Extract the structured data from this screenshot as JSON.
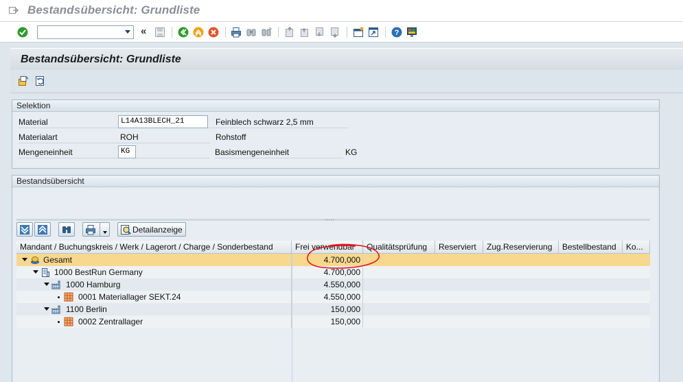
{
  "window": {
    "title": "Bestandsübersicht: Grundliste"
  },
  "toolbar": {
    "command_value": "",
    "more_symbol": "«"
  },
  "screen": {
    "title": "Bestandsübersicht: Grundliste"
  },
  "selektion": {
    "title": "Selektion",
    "material_label": "Material",
    "material_value": "L14A13BLECH_21",
    "material_text": "Feinblech schwarz 2,5 mm",
    "materialart_label": "Materialart",
    "materialart_value": "ROH",
    "materialart_text": "Rohstoff",
    "mengeneinheit_label": "Mengeneinheit",
    "mengeneinheit_value": "KG",
    "basismengeneinheit_label": "Basismengeneinheit",
    "basismengeneinheit_value": "KG"
  },
  "bestand": {
    "title": "Bestandsübersicht",
    "splitter": ".....",
    "detail_button": "Detailanzeige",
    "columns": [
      "Mandant / Buchungskreis / Werk / Lagerort / Charge / Sonderbestand",
      "Frei verwendbar",
      "Qualitätsprüfung",
      "Reserviert",
      "Zug.Reservierung",
      "Bestellbestand",
      "Ko..."
    ],
    "rows": [
      {
        "label": "Gesamt",
        "value": "4.700,000"
      },
      {
        "label": "1000 BestRun Germany",
        "value": "4.700,000"
      },
      {
        "label": "1000 Hamburg",
        "value": "4.550,000"
      },
      {
        "label": "0001 Materiallager SEKT.24",
        "value": "4.550,000"
      },
      {
        "label": "1100 Berlin",
        "value": "150,000"
      },
      {
        "label": "0002 Zentrallager",
        "value": "150,000"
      }
    ]
  },
  "colors": {
    "highlight_row": "#f8d88f",
    "annotation": "#e0141e",
    "sap_blue": "#1c3f66"
  }
}
